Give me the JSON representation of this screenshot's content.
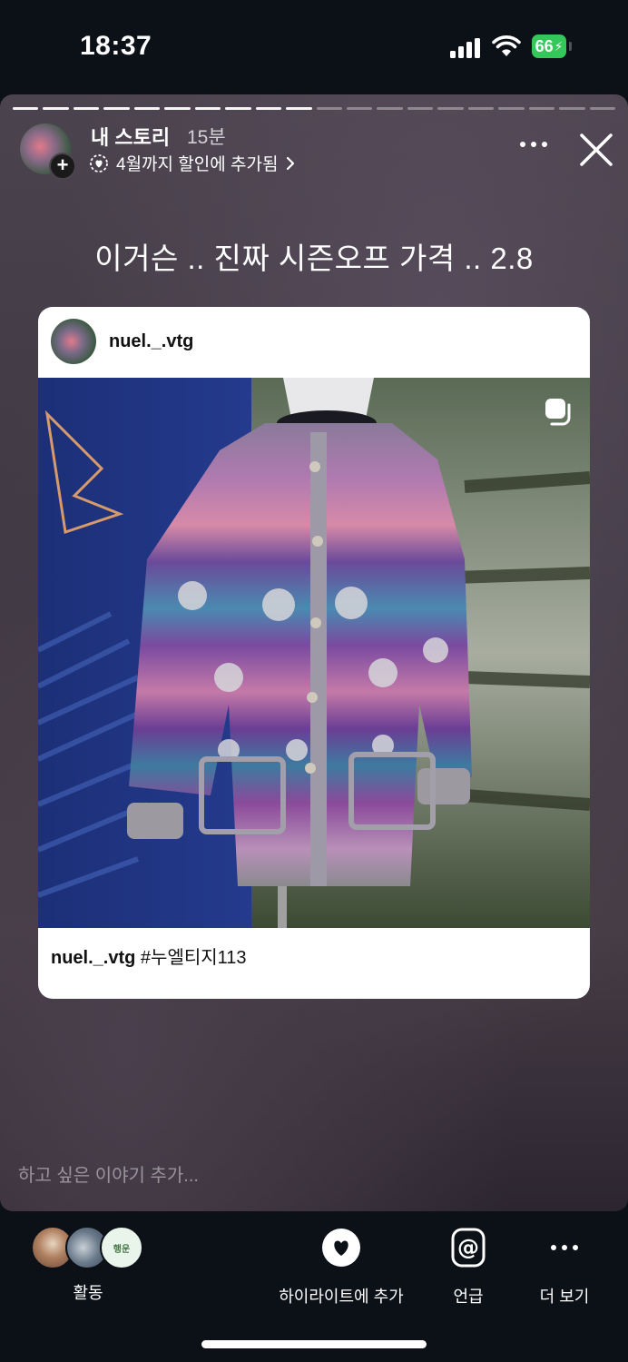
{
  "status_bar": {
    "time": "18:37",
    "battery": "66"
  },
  "story": {
    "user": "내 스토리",
    "time_ago": "15분",
    "added_to": "4월까지 할인에 추가됨",
    "text": "이거슨 .. 진짜 시즌오프 가격 .. 2.8",
    "progress_total": 20,
    "progress_done": 10
  },
  "post": {
    "username": "nuel._.vtg",
    "caption_user": "nuel._.vtg",
    "caption_text": "#누엘티지113"
  },
  "reply": {
    "placeholder": "하고 싶은 이야기 추가..."
  },
  "actions": {
    "viewer_badge": "행운",
    "activity": "활동",
    "highlight": "하이라이트에 추가",
    "mention": "언급",
    "more": "더 보기"
  }
}
